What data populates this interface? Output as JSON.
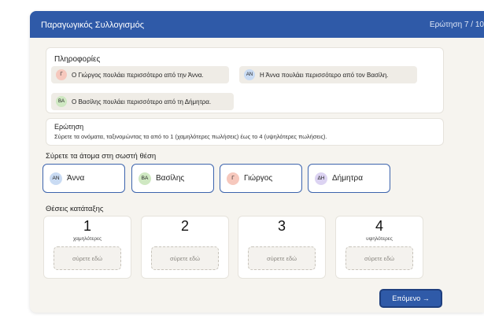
{
  "header": {
    "title": "Παραγωγικός Συλλογισμός",
    "progress": "Ερώτηση 7 / 10"
  },
  "info": {
    "heading": "Πληροφορίες",
    "facts": [
      {
        "initials": "Γ",
        "text": "Ο Γιώργος πουλάει περισσότερο από την Άννα.",
        "color": "#f6c8bd"
      },
      {
        "initials": "ΑΝ",
        "text": "Η Άννα πουλάει περισσότερο από τον Βασίλη.",
        "color": "#c9dbf3"
      },
      {
        "initials": "ΒΑ",
        "text": "Ο Βασίλης πουλάει περισσότερο από τη Δήμητρα.",
        "color": "#cfe8c2"
      }
    ]
  },
  "question": {
    "title": "Ερώτηση",
    "text": "Σύρετε τα ονόματα, ταξινομώντας τα από το 1 (χαμηλότερες πωλήσεις) έως το 4 (υψηλότερες πωλήσεις)."
  },
  "drag_instruction": "Σύρετε τα άτομα στη σωστή θέση",
  "people": [
    {
      "initials": "ΑΝ",
      "name": "Άννα",
      "color": "#c9dbf3"
    },
    {
      "initials": "ΒΑ",
      "name": "Βασίλης",
      "color": "#cfe8c2"
    },
    {
      "initials": "Γ",
      "name": "Γιώργος",
      "color": "#f6c8bd"
    },
    {
      "initials": "ΔΗ",
      "name": "Δήμητρα",
      "color": "#dcd3f2"
    }
  ],
  "ranking": {
    "title": "Θέσεις κατάταξης",
    "slots": [
      {
        "number": "1",
        "sub": "χαμηλότερες",
        "placeholder": "σύρετε εδώ"
      },
      {
        "number": "2",
        "sub": "",
        "placeholder": "σύρετε εδώ"
      },
      {
        "number": "3",
        "sub": "",
        "placeholder": "σύρετε εδώ"
      },
      {
        "number": "4",
        "sub": "υψηλότερες",
        "placeholder": "σύρετε εδώ"
      }
    ]
  },
  "next_button": "Επόμενο →",
  "colors": {
    "accent": "#2f5aa8",
    "background": "#f6f4ef"
  }
}
